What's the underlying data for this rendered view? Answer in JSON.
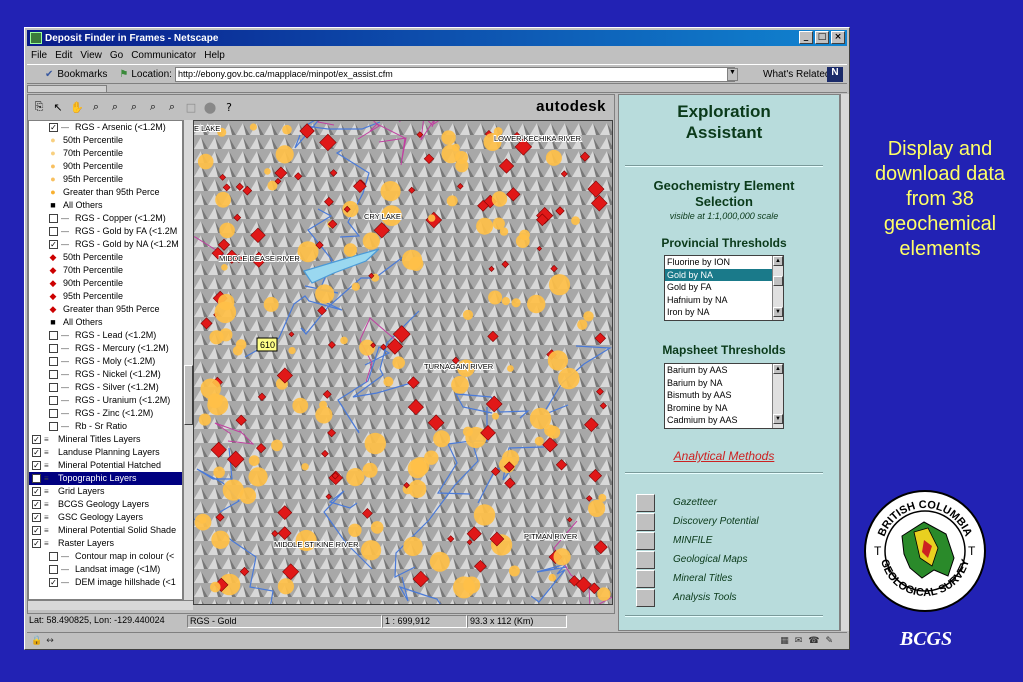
{
  "window": {
    "title": "Deposit Finder in Frames - Netscape",
    "minimize": "_",
    "maximize": "□",
    "close": "×"
  },
  "menu": [
    "File",
    "Edit",
    "View",
    "Go",
    "Communicator",
    "Help"
  ],
  "location_bar": {
    "bookmarks": "Bookmarks",
    "location_label": "Location:",
    "url": "http://ebony.gov.bc.ca/mapplace/minpot/ex_assist.cfm",
    "whats_related": "What's Related"
  },
  "map_toolbar": {
    "brand": "autodesk",
    "tools": [
      "copy-icon",
      "arrow-icon",
      "hand-icon",
      "zoom-in-icon",
      "zoom-out-icon",
      "zoom-previous-icon",
      "zoom-goto-icon",
      "zoom-width-icon",
      "page-icon",
      "stop-icon",
      "help-icon"
    ]
  },
  "legend": [
    {
      "cb": "✓",
      "icon": "line",
      "label": "RGS - Arsenic (<1.2M)"
    },
    {
      "dot": "●",
      "color": "#f8d080",
      "label": "50th Percentile"
    },
    {
      "dot": "●",
      "color": "#f8d080",
      "label": "70th Percentile"
    },
    {
      "dot": "●",
      "color": "#f8c060",
      "label": "90th Percentile"
    },
    {
      "dot": "●",
      "color": "#f8c060",
      "label": "95th Percentile"
    },
    {
      "dot": "●",
      "color": "#f8b030",
      "label": "Greater than 95th Perce"
    },
    {
      "dot": "■",
      "color": "#000000",
      "label": "All Others"
    },
    {
      "cb": "",
      "icon": "line",
      "label": "RGS - Copper (<1.2M)"
    },
    {
      "cb": "",
      "icon": "line",
      "label": "RGS - Gold by FA (<1.2M"
    },
    {
      "cb": "✓",
      "icon": "line",
      "label": "RGS - Gold by NA (<1.2M"
    },
    {
      "dot": "◆",
      "color": "#cc0000",
      "label": "50th Percentile"
    },
    {
      "dot": "◆",
      "color": "#cc0000",
      "label": "70th Percentile"
    },
    {
      "dot": "◆",
      "color": "#cc0000",
      "label": "90th Percentile"
    },
    {
      "dot": "◆",
      "color": "#cc0000",
      "label": "95th Percentile"
    },
    {
      "dot": "◆",
      "color": "#cc0000",
      "label": "Greater than 95th Perce"
    },
    {
      "dot": "■",
      "color": "#000000",
      "label": "All Others"
    },
    {
      "cb": "",
      "icon": "line",
      "label": "RGS - Lead (<1.2M)"
    },
    {
      "cb": "",
      "icon": "line",
      "label": "RGS - Mercury (<1.2M)"
    },
    {
      "cb": "",
      "icon": "line",
      "label": "RGS - Moly (<1.2M)"
    },
    {
      "cb": "",
      "icon": "line",
      "label": "RGS - Nickel (<1.2M)"
    },
    {
      "cb": "",
      "icon": "line",
      "label": "RGS - Silver (<1.2M)"
    },
    {
      "cb": "",
      "icon": "line",
      "label": "RGS - Uranium (<1.2M)"
    },
    {
      "cb": "",
      "icon": "line",
      "label": "RGS - Zinc (<1.2M)"
    },
    {
      "cb": "",
      "icon": "line",
      "label": "Rb - Sr Ratio"
    },
    {
      "cb": "✓",
      "icon": "group",
      "label": "Mineral Titles Layers"
    },
    {
      "cb": "✓",
      "icon": "group",
      "label": "Landuse Planning Layers"
    },
    {
      "cb": "✓",
      "icon": "group",
      "label": "Mineral Potential Hatched"
    },
    {
      "cb": "✓",
      "icon": "group",
      "label": "Topographic Layers",
      "selected": true
    },
    {
      "cb": "✓",
      "icon": "group",
      "label": "Grid Layers"
    },
    {
      "cb": "✓",
      "icon": "group",
      "label": "BCGS Geology Layers"
    },
    {
      "cb": "✓",
      "icon": "group",
      "label": "GSC Geology Layers"
    },
    {
      "cb": "✓",
      "icon": "group",
      "label": "Mineral Potential Solid Shade"
    },
    {
      "cb": "✓",
      "icon": "group",
      "label": "Raster Layers"
    },
    {
      "cb": "",
      "icon": "line",
      "label": "Contour map in colour (<"
    },
    {
      "cb": "",
      "icon": "line",
      "label": "Landsat image (<1M)"
    },
    {
      "cb": "✓",
      "icon": "line",
      "label": "DEM image hillshade (<1"
    }
  ],
  "map": {
    "labels": [
      "E LAKE",
      "LOWER KECHIKA RIVER",
      "CRY LAKE",
      "MIDDLE DEASE RIVER",
      "TURNAGAIN RIVER",
      "MIDDLE STIKINE RIVER",
      "PITMAN RIVER"
    ],
    "marker": "610"
  },
  "status": {
    "coords": "Lat: 58.490825, Lon: -129.440024",
    "layer": "RGS - Gold",
    "scale": "1 : 699,912",
    "size": "93.3 x 112 (Km)"
  },
  "assistant": {
    "title_line1": "Exploration",
    "title_line2": "Assistant",
    "section_line1": "Geochemistry Element",
    "section_line2": "Selection",
    "visibility": "visible at 1:1,000,000 scale",
    "provincial_heading": "Provincial Thresholds",
    "provincial_options": [
      "Fluorine by ION",
      "Gold by NA",
      "Gold by FA",
      "Hafnium by NA",
      "Iron by NA"
    ],
    "provincial_selected": "Gold by NA",
    "mapsheet_heading": "Mapsheet Thresholds",
    "mapsheet_options": [
      "Barium by AAS",
      "Barium by NA",
      "Bismuth by AAS",
      "Bromine by NA",
      "Cadmium by AAS"
    ],
    "analytical_link": "Analytical Methods",
    "nav_buttons": [
      "Gazetteer",
      "Discovery Potential",
      "MINFILE",
      "Geological Maps",
      "Mineral Titles",
      "Analysis Tools"
    ]
  },
  "side_caption": "Display and download data from 38 geochemical elements",
  "seal": {
    "top": "BRITISH COLUMBIA",
    "bottom": "GEOLOGICAL SURVEY",
    "left": "T",
    "right": "T"
  },
  "bcgs": "BCGS",
  "colors": {
    "background": "#2222b4",
    "caption": "#ffff66",
    "panel": "#b8dcdc",
    "heading": "#0a3a1a",
    "link": "#cc2222"
  }
}
